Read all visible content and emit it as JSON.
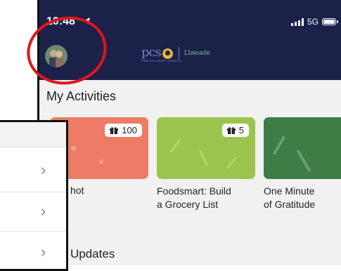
{
  "status_bar": {
    "time": "10:48",
    "network": "5G"
  },
  "header": {
    "logo_text": "pcs",
    "logo_subtitle": "PINELLAS COUNTY SCHOOLS",
    "school_name": "11meade"
  },
  "activities": {
    "section_title": "My Activities",
    "cards": [
      {
        "points": "100",
        "title_visible": "hot",
        "color": "#ee7b65"
      },
      {
        "points": "5",
        "title": "Foodsmart: Build a Grocery List",
        "title_line1": "Foodsmart: Build",
        "title_line2": "a Grocery List",
        "color": "#9bc44f"
      },
      {
        "title_line1": "One Minute",
        "title_line2": "of Gratitude",
        "color": "#3e7d46"
      }
    ]
  },
  "updates": {
    "section_title": "Updates"
  },
  "overlay_panel": {
    "rows": 3
  },
  "colors": {
    "header_bg": "#1b2149",
    "annotation": "#e0161a"
  },
  "icons": [
    "location-arrow-icon",
    "signal-icon",
    "battery-icon",
    "gift-icon",
    "chevron-right-icon",
    "avatar"
  ]
}
